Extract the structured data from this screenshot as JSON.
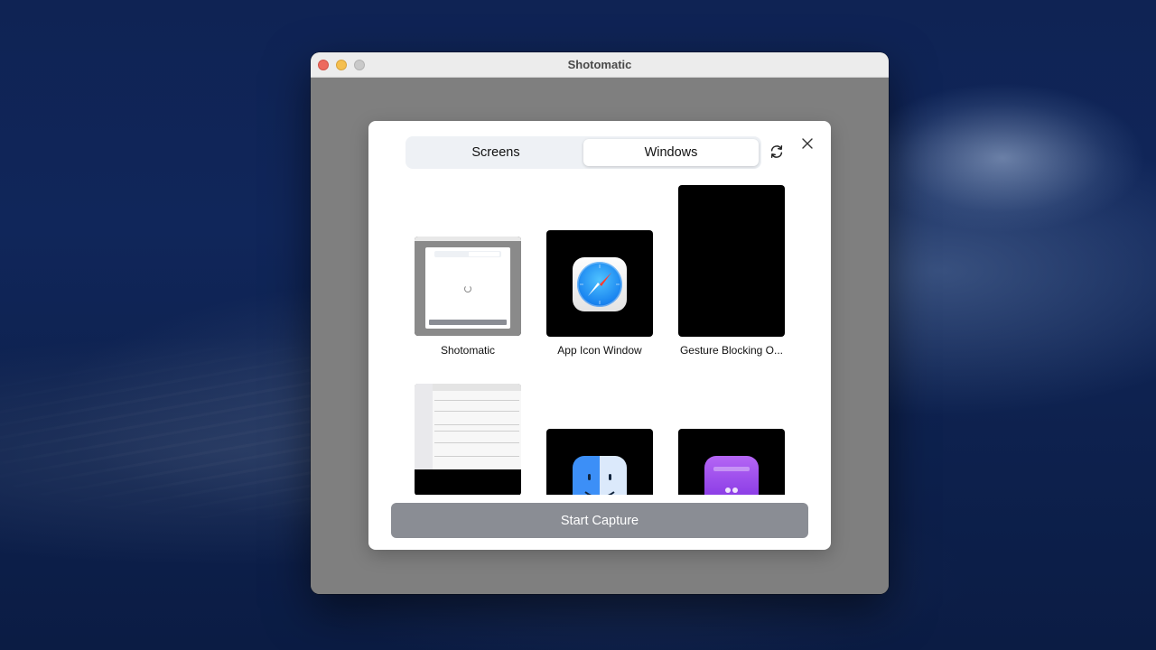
{
  "window": {
    "title": "Shotomatic"
  },
  "dialog": {
    "tabs": [
      {
        "label": "Screens",
        "selected": false
      },
      {
        "label": "Windows",
        "selected": true
      }
    ],
    "refresh_icon": "refresh-icon",
    "close_icon": "close-icon",
    "windows": [
      {
        "name": "Shotomatic",
        "thumbnail": "shotomatic-preview"
      },
      {
        "name": "App Icon Window",
        "thumbnail": "safari-app-icon"
      },
      {
        "name": "Gesture Blocking O...",
        "thumbnail": "black-window"
      },
      {
        "name": "",
        "thumbnail": "finder-window-screenshot"
      },
      {
        "name": "",
        "thumbnail": "finder-app-icon"
      },
      {
        "name": "",
        "thumbnail": "purple-app-icon"
      }
    ],
    "start_button": "Start Capture"
  },
  "colors": {
    "button_disabled": "#8a8d94",
    "segmented_bg": "#eef1f5",
    "window_body": "#7f7f7f"
  }
}
